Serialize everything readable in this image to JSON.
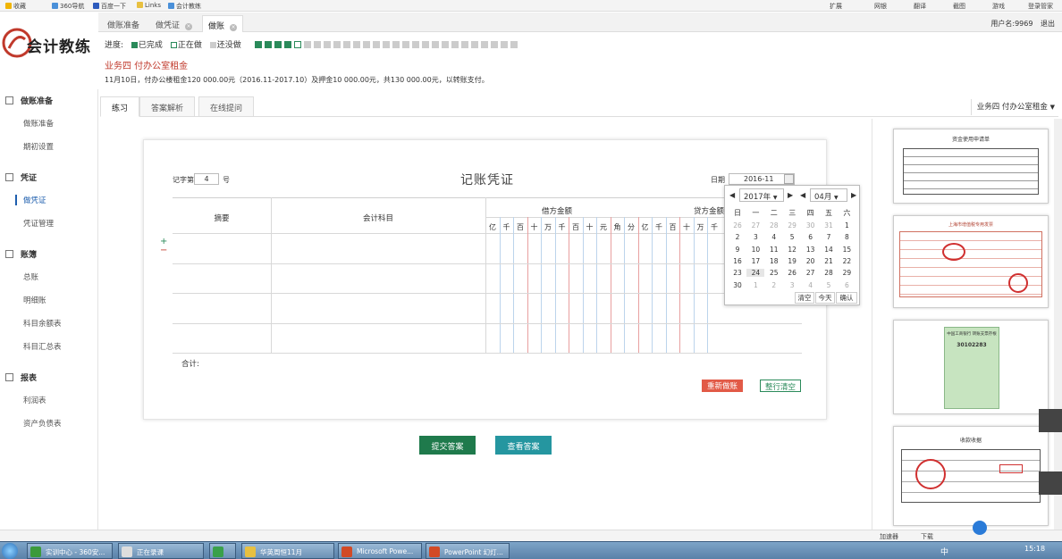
{
  "bookmarks": [
    "收藏",
    "360导航",
    "百度一下",
    "Links",
    "会计教练"
  ],
  "browser_tools": [
    "扩展",
    "网银",
    "翻译",
    "截图",
    "游戏",
    "登录管家"
  ],
  "tabs": [
    {
      "label": "做账准备"
    },
    {
      "label": "做凭证"
    },
    {
      "label": "做账"
    }
  ],
  "user": {
    "label": "用户名:9969",
    "logout": "退出"
  },
  "logo": "会计教练",
  "progress": {
    "label": "进度:",
    "done": "已完成",
    "doing": "正在做",
    "todo": "还没做",
    "done_count": 4,
    "doing_count": 1,
    "todo_count": 22,
    "colors": {
      "done": "#2a8a5a",
      "doing": "#ffffff",
      "todo": "#cccccc"
    }
  },
  "business": {
    "title": "业务四 付办公室租金",
    "desc": "11月10日，付办公楼租金120 000.00元（2016.11-2017.10）及押金10 000.00元，共130 000.00元，以转账支付。"
  },
  "sidebar": [
    {
      "section": "做账准备",
      "items": [
        "做账准备",
        "期初设置"
      ]
    },
    {
      "section": "凭证",
      "items": [
        "做凭证",
        "凭证管理"
      ]
    },
    {
      "section": "账簿",
      "items": [
        "总账",
        "明细账",
        "科目余额表",
        "科目汇总表"
      ]
    },
    {
      "section": "报表",
      "items": [
        "利润表",
        "资产负债表"
      ]
    }
  ],
  "inner_tabs": [
    "练习",
    "答案解析",
    "在线提问"
  ],
  "biz_select": "业务四 付办公室租金",
  "voucher": {
    "ji_label": "记字第",
    "number": "4",
    "hao": "号",
    "title": "记账凭证",
    "date_label": "日期",
    "date_value": "2016-11",
    "col_summary": "摘要",
    "col_account": "会计科目",
    "col_debit": "借方金额",
    "col_credit": "贷方金额",
    "digits": [
      "亿",
      "千",
      "百",
      "十",
      "万",
      "千",
      "百",
      "十",
      "元",
      "角",
      "分",
      "亿",
      "千",
      "百",
      "十",
      "万",
      "千"
    ],
    "total_label": "合计:",
    "add_row": "+",
    "remove_row": "−",
    "reset_button": "重新做账",
    "clear_button": "整行清空"
  },
  "calendar": {
    "year": "2017年",
    "month": "04月",
    "weekdays": [
      "日",
      "一",
      "二",
      "三",
      "四",
      "五",
      "六"
    ],
    "days": [
      [
        "26",
        "27",
        "28",
        "29",
        "30",
        "31",
        "1"
      ],
      [
        "2",
        "3",
        "4",
        "5",
        "6",
        "7",
        "8"
      ],
      [
        "9",
        "10",
        "11",
        "12",
        "13",
        "14",
        "15"
      ],
      [
        "16",
        "17",
        "18",
        "19",
        "20",
        "21",
        "22"
      ],
      [
        "23",
        "24",
        "25",
        "26",
        "27",
        "28",
        "29"
      ],
      [
        "30",
        "1",
        "2",
        "3",
        "4",
        "5",
        "6"
      ]
    ],
    "buttons": [
      "清空",
      "今天",
      "确认"
    ]
  },
  "actions": {
    "submit": "提交答案",
    "view": "查看答案"
  },
  "thumb_titles": [
    "资金使用申请单",
    "上海市增值税专用发票",
    "中国工商银行 转账支票存根",
    "收款收据"
  ],
  "thumb_texts": [
    "30102283"
  ],
  "status": {
    "accel": "加速器",
    "download": "下载"
  },
  "taskbar": {
    "items": [
      "实训中心 - 360安...",
      "正在录课",
      "",
      "华英周恒11月",
      "Microsoft Powe...",
      "PowerPoint 幻灯..."
    ],
    "time": "15:18",
    "ime": "中"
  }
}
